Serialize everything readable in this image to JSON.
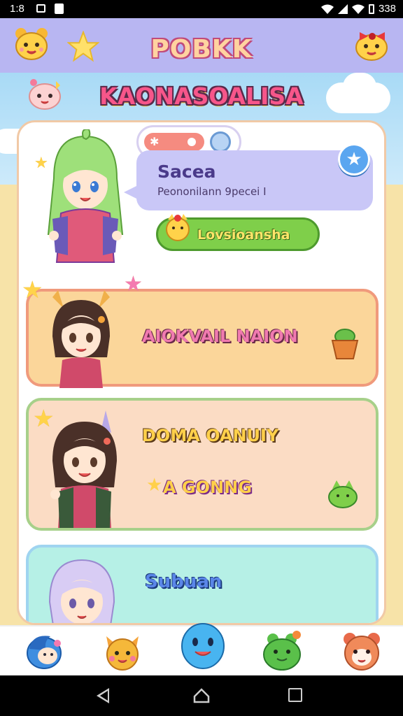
{
  "status_bar": {
    "time": "1:8",
    "battery": "338"
  },
  "header": {
    "title": "POBKK"
  },
  "banner": {
    "subtitle": "KAONASOALISA"
  },
  "profile": {
    "name": "Sacea",
    "description": "Peononilann 9pecei I",
    "action_label": "Lovsioansha"
  },
  "cards": [
    {
      "title": "AIOKVAIL NAION",
      "icon": "plant-pot-icon"
    },
    {
      "title": "DOMA OANUIY",
      "sub_label": "A GONNG",
      "icon": "frog-icon"
    },
    {
      "title": "Subuan"
    }
  ],
  "bottom_nav": {
    "items": [
      {
        "icon": "blue-bird-icon",
        "color": "#3f8ee0"
      },
      {
        "icon": "fox-face-icon",
        "color": "#f5a43a"
      },
      {
        "icon": "blue-blob-icon",
        "color": "#48b4f0"
      },
      {
        "icon": "green-frog-icon",
        "color": "#5ac04a"
      },
      {
        "icon": "bear-face-icon",
        "color": "#f08a5a"
      }
    ]
  },
  "colors": {
    "header": "#b8b6f2",
    "accent_pink": "#f7568a",
    "accent_green": "#7fcf4a",
    "panel_border": "#f1c9a6"
  }
}
